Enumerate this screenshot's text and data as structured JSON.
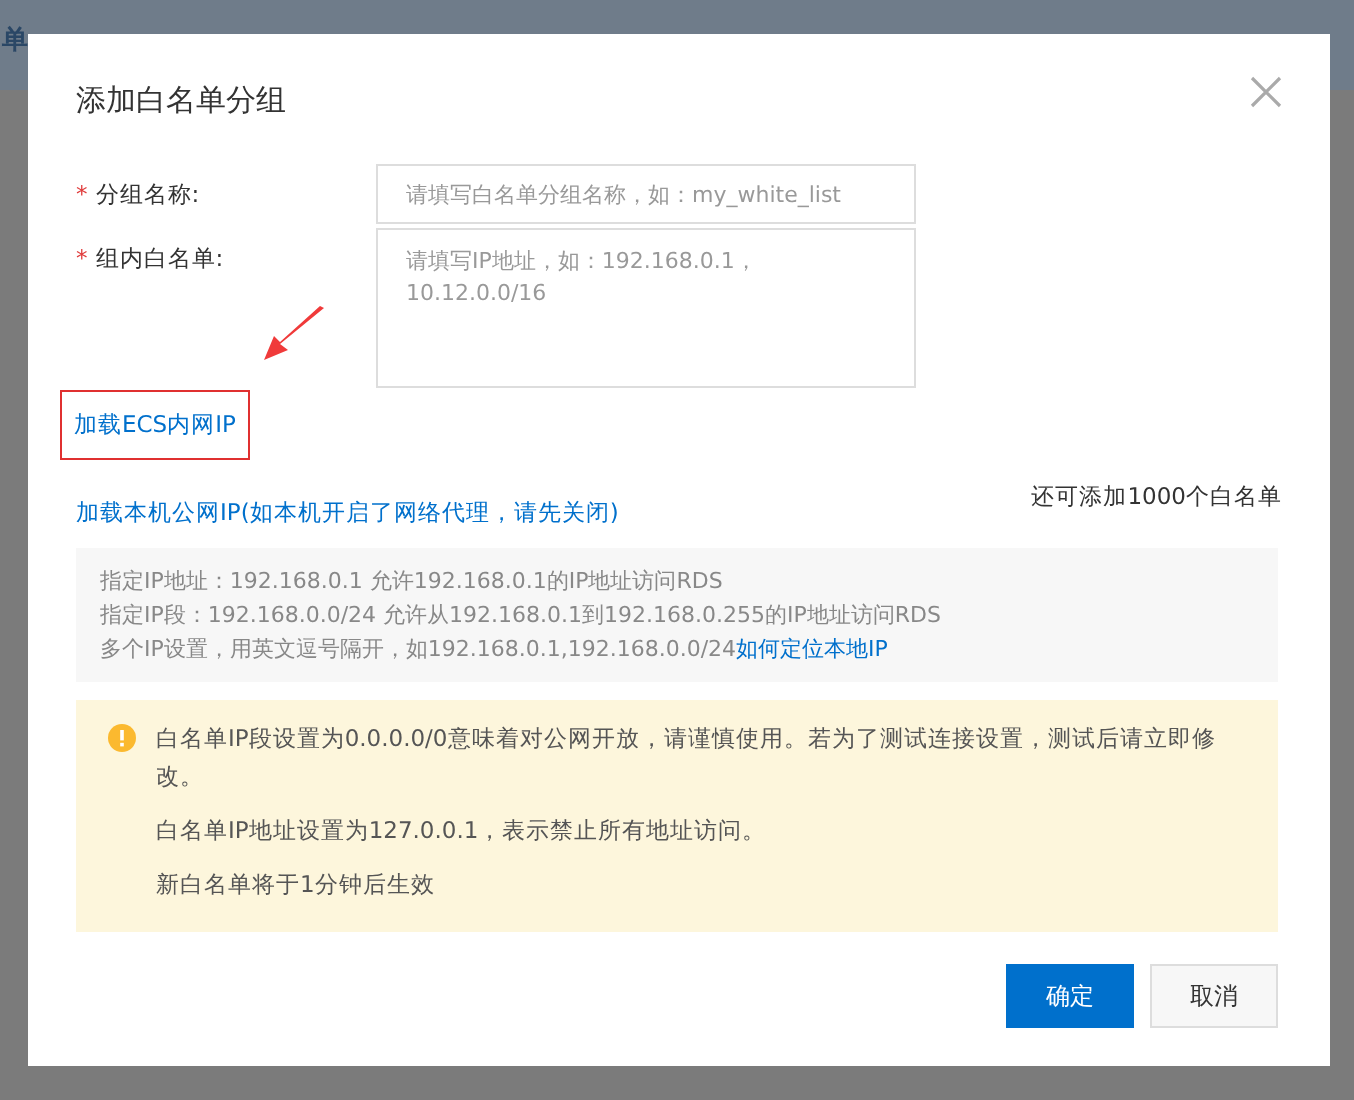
{
  "background_text": "单",
  "required_mark": "*",
  "dialog": {
    "title": "添加白名单分组",
    "fields": [
      {
        "label": "分组名称:",
        "required": true,
        "kind": "input",
        "placeholder": "请填写白名单分组名称，如：my_white_list"
      },
      {
        "label": "组内白名单:",
        "required": true,
        "kind": "textarea",
        "placeholder": "请填写IP地址，如：192.168.0.1，10.12.0.0/16"
      }
    ],
    "links": [
      {
        "label": "加载ECS内网IP",
        "highlighted": true
      },
      {
        "label": "加载本机公网IP(如本机开启了网络代理，请先关闭)",
        "highlighted": false
      }
    ],
    "remaining": "还可添加1000个白名单",
    "info_lines": [
      "指定IP地址：192.168.0.1 允许192.168.0.1的IP地址访问RDS",
      "指定IP段：192.168.0.0/24 允许从192.168.0.1到192.168.0.255的IP地址访问RDS",
      "多个IP设置，用英文逗号隔开，如192.168.0.1,192.168.0.0/24"
    ],
    "info_link": "如何定位本地IP",
    "warnings": [
      "白名单IP段设置为0.0.0.0/0意味着对公网开放，请谨慎使用。若为了测试连接设置，测试后请立即修改。",
      "白名单IP地址设置为127.0.0.1，表示禁止所有地址访问。",
      "新白名单将于1分钟后生效"
    ],
    "buttons": [
      {
        "label": "确定",
        "kind": "primary"
      },
      {
        "label": "取消",
        "kind": "secondary"
      }
    ]
  }
}
